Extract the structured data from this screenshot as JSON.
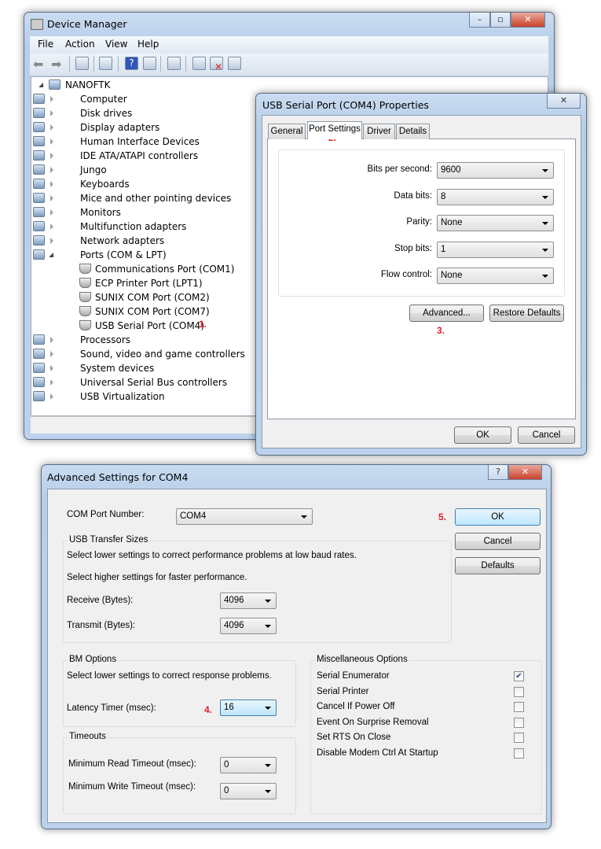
{
  "device_manager": {
    "title": "Device Manager",
    "menu": [
      "File",
      "Action",
      "View",
      "Help"
    ],
    "toolbar_icons": [
      "back-arrow-icon",
      "forward-arrow-icon",
      "show-hide-console-tree-icon",
      "properties-icon",
      "help-icon",
      "action-pane-icon",
      "scan-hardware-icon",
      "update-driver-icon",
      "uninstall-icon",
      "disable-device-icon"
    ],
    "root": "NANOFTK",
    "items": [
      "Computer",
      "Disk drives",
      "Display adapters",
      "Human Interface Devices",
      "IDE ATA/ATAPI controllers",
      "Jungo",
      "Keyboards",
      "Mice and other pointing devices",
      "Monitors",
      "Multifunction adapters",
      "Network adapters",
      "Ports (COM & LPT)"
    ],
    "ports": [
      "Communications Port (COM1)",
      "ECP Printer Port (LPT1)",
      "SUNIX COM Port (COM2)",
      "SUNIX COM Port (COM7)",
      "USB Serial Port (COM4)"
    ],
    "items_after": [
      "Processors",
      "Sound, video and game controllers",
      "System devices",
      "Universal Serial Bus controllers",
      "USB Virtualization"
    ]
  },
  "properties": {
    "title": "USB Serial Port (COM4) Properties",
    "tabs": [
      "General",
      "Port Settings",
      "Driver",
      "Details"
    ],
    "active_tab": "Port Settings",
    "fields": [
      {
        "label": "Bits per second:",
        "value": "9600"
      },
      {
        "label": "Data bits:",
        "value": "8"
      },
      {
        "label": "Parity:",
        "value": "None"
      },
      {
        "label": "Stop bits:",
        "value": "1"
      },
      {
        "label": "Flow control:",
        "value": "None"
      }
    ],
    "advanced_label": "Advanced...",
    "restore_label": "Restore Defaults",
    "ok_label": "OK",
    "cancel_label": "Cancel"
  },
  "advanced": {
    "title": "Advanced Settings for COM4",
    "help": "?",
    "com_port_label": "COM Port Number:",
    "com_port_value": "COM4",
    "usb_title": "USB Transfer Sizes",
    "usb_text1": "Select lower settings to correct performance problems at low baud rates.",
    "usb_text2": "Select higher settings for faster performance.",
    "receive_label": "Receive (Bytes):",
    "receive_value": "4096",
    "transmit_label": "Transmit (Bytes):",
    "transmit_value": "4096",
    "bm_title": "BM Options",
    "bm_text": "Select lower settings to correct response problems.",
    "latency_label": "Latency Timer (msec):",
    "latency_value": "16",
    "timeouts_title": "Timeouts",
    "read_label": "Minimum Read Timeout (msec):",
    "read_value": "0",
    "write_label": "Minimum Write Timeout (msec):",
    "write_value": "0",
    "misc_title": "Miscellaneous Options",
    "misc": [
      {
        "label": "Serial Enumerator",
        "checked": true
      },
      {
        "label": "Serial Printer",
        "checked": false
      },
      {
        "label": "Cancel If Power Off",
        "checked": false
      },
      {
        "label": "Event On Surprise Removal",
        "checked": false
      },
      {
        "label": "Set RTS On Close",
        "checked": false
      },
      {
        "label": "Disable Modem Ctrl At Startup",
        "checked": false
      }
    ],
    "ok_label": "OK",
    "cancel_label": "Cancel",
    "defaults_label": "Defaults"
  },
  "annotations": [
    "1.",
    "2.",
    "3.",
    "4.",
    "5."
  ],
  "colors": {
    "annotation": "#e0202a",
    "chrome": "#bcd2ec",
    "close": "#c9422c"
  }
}
